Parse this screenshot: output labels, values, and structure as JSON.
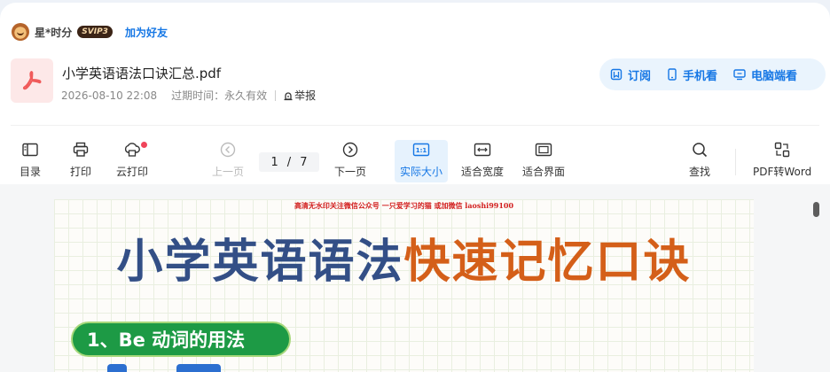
{
  "user": {
    "name": "星*时分",
    "vip_badge": "SVIP3",
    "add_friend": "加为好友"
  },
  "file": {
    "title": "小学英语语法口诀汇总.pdf",
    "date": "2026-08-10 22:08",
    "expiry_label": "过期时间：",
    "expiry_value": "永久有效",
    "report": "举报"
  },
  "actions": [
    {
      "label": "订阅",
      "icon": "subscribe-icon"
    },
    {
      "label": "手机看",
      "icon": "phone-icon"
    },
    {
      "label": "电脑端看",
      "icon": "desktop-icon"
    }
  ],
  "toolbar": {
    "toc": "目录",
    "print": "打印",
    "cloud_print": "云打印",
    "prev_page": "上一页",
    "current_page": "1",
    "page_sep": "/",
    "total_pages": "7",
    "next_page": "下一页",
    "actual_size": "实际大小",
    "actual_size_icon_text": "1:1",
    "fit_width": "适合宽度",
    "fit_page": "适合界面",
    "find": "查找",
    "pdf_to_word": "PDF转Word"
  },
  "document": {
    "watermark": "高清无水印关注微信公众号 一只爱学习的猫 或加微信 laoshi99100",
    "title_part1": "小学英语语法",
    "title_part2": "快速记忆口诀",
    "section_heading": "1、Be 动词的用法"
  },
  "colors": {
    "accent_blue": "#1677e5",
    "title_blue": "#334f86",
    "title_orange": "#d45f19",
    "section_green": "#1d9a45",
    "notification_red": "#f0445a"
  }
}
